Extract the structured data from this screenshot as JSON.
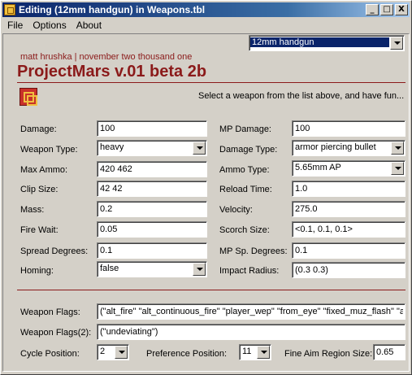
{
  "window": {
    "title": "Editing (12mm handgun) in Weapons.tbl",
    "minimize_glyph": "_",
    "maximize_glyph": "□",
    "close_glyph": "X"
  },
  "menu": {
    "items": [
      "File",
      "Options",
      "About"
    ]
  },
  "weapon_select": {
    "value": "12mm handgun"
  },
  "header": {
    "author": "matt hrushka | november two thousand one",
    "app_title": "ProjectMars v.01 beta 2b",
    "tagline": "Select a weapon from the list above, and have fun..."
  },
  "left_fields": {
    "damage": {
      "label": "Damage:",
      "value": "100"
    },
    "weapon_type": {
      "label": "Weapon Type:",
      "value": "heavy"
    },
    "max_ammo": {
      "label": "Max Ammo:",
      "value": "420 462"
    },
    "clip_size": {
      "label": "Clip Size:",
      "value": "42 42"
    },
    "mass": {
      "label": "Mass:",
      "value": "0.2"
    },
    "fire_wait": {
      "label": "Fire Wait:",
      "value": "0.05"
    },
    "spread_degrees": {
      "label": "Spread Degrees:",
      "value": "0.1"
    },
    "homing": {
      "label": "Homing:",
      "value": "false"
    }
  },
  "right_fields": {
    "mp_damage": {
      "label": "MP Damage:",
      "value": "100"
    },
    "damage_type": {
      "label": "Damage Type:",
      "value": "armor piercing bullet"
    },
    "ammo_type": {
      "label": "Ammo Type:",
      "value": "5.65mm AP"
    },
    "reload_time": {
      "label": "Reload Time:",
      "value": "1.0"
    },
    "velocity": {
      "label": "Velocity:",
      "value": "275.0"
    },
    "scorch_size": {
      "label": "Scorch Size:",
      "value": "<0.1, 0.1, 0.1>"
    },
    "mp_spread_degrees": {
      "label": "MP Sp. Degrees:",
      "value": "0.1"
    },
    "impact_radius": {
      "label": "Impact Radius:",
      "value": "(0.3 0.3)"
    }
  },
  "flags": {
    "weapon_flags": {
      "label": "Weapon Flags:",
      "value": "(\"alt_fire\" \"alt_continuous_fire\" \"player_wep\" \"from_eye\" \"fixed_muz_flash\" \"a"
    },
    "weapon_flags2": {
      "label": "Weapon Flags(2):",
      "value": "(\"undeviating\")"
    }
  },
  "bottom": {
    "cycle_position": {
      "label": "Cycle Position:",
      "value": "2"
    },
    "preference_position": {
      "label": "Preference Position:",
      "value": "11"
    },
    "fine_aim": {
      "label": "Fine Aim Region Size:",
      "value": "0.65"
    }
  },
  "colors": {
    "accent_red": "#8b1a1a",
    "title_bar": "#0a246a",
    "face": "#d4d0c8"
  }
}
